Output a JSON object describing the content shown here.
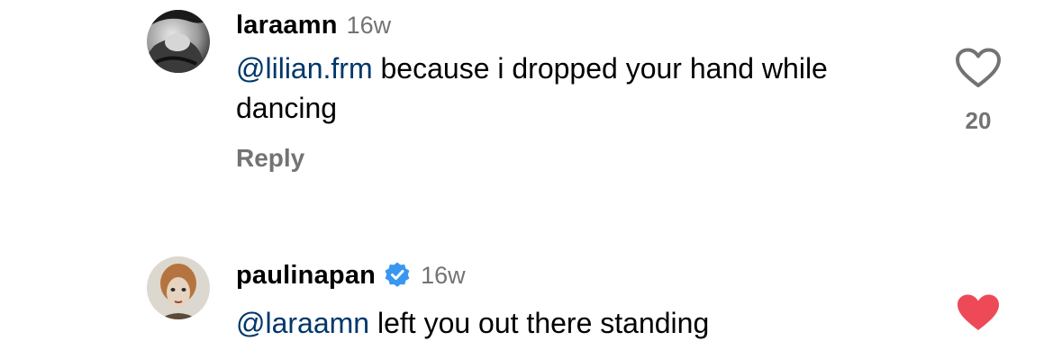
{
  "colors": {
    "mention": "#00376b",
    "secondary_text": "#737373",
    "liked_red": "#ed4956",
    "verified_blue": "#3897f0"
  },
  "comments": [
    {
      "username": "laraamn",
      "time": "16w",
      "mention": "@lilian.frm",
      "text": " because i dropped your hand while dancing",
      "reply_label": "Reply",
      "like_count": "20",
      "liked": false,
      "verified": false,
      "like_icon": "heart-outline-icon"
    },
    {
      "username": "paulinapan",
      "time": "16w",
      "mention": "@laraamn",
      "text": " left you out there standing",
      "liked": true,
      "verified": true,
      "like_icon": "heart-filled-icon"
    }
  ]
}
